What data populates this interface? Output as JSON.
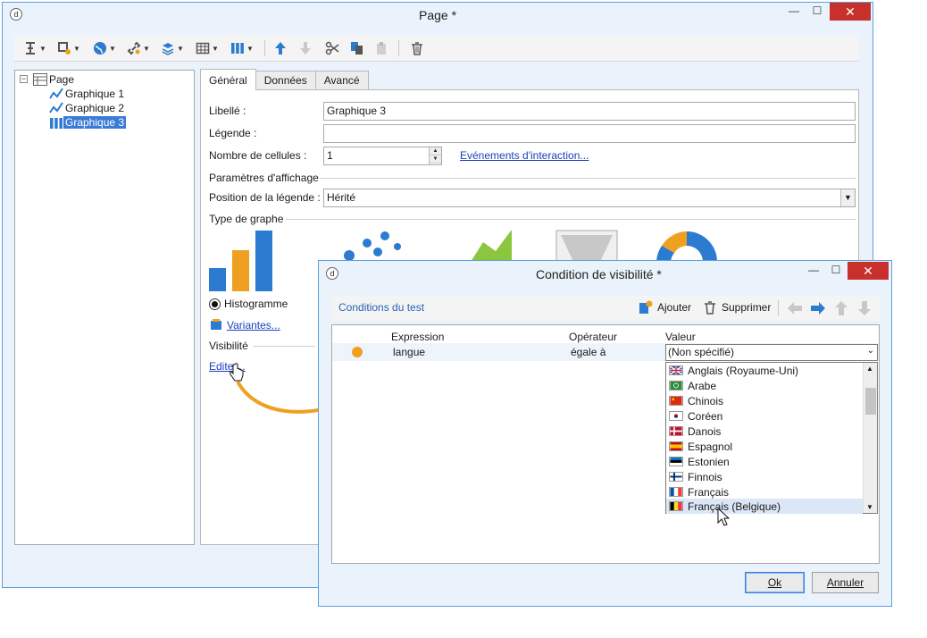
{
  "main_window": {
    "title": "Page *",
    "buttons": {
      "minimize": "—",
      "maximize": "☐",
      "close": "✕"
    },
    "toolbar": {
      "icons": [
        "insert-icon",
        "format-icon",
        "globe-icon",
        "link-icon",
        "layers-icon",
        "table-icon",
        "columns-icon",
        "arrow-up-icon",
        "arrow-down-icon",
        "scissors-icon",
        "copy-icon",
        "paste-icon",
        "trash-icon"
      ]
    },
    "tree": {
      "root": "Page",
      "children": [
        "Graphique 1",
        "Graphique 2",
        "Graphique 3"
      ],
      "selected": "Graphique 3"
    },
    "tabs": [
      "Général",
      "Données",
      "Avancé"
    ],
    "form": {
      "libelle_label": "Libellé :",
      "libelle_value": "Graphique 3",
      "legende_label": "Légende :",
      "legende_value": "",
      "cells_label": "Nombre de cellules :",
      "cells_value": "1",
      "events_link": "Evénements d'interaction...",
      "display_params": "Paramètres d'affichage",
      "legend_pos_label": "Position de la légende :",
      "legend_pos_value": "Hérité",
      "graph_type": "Type de graphe",
      "histogram_label": "Histogramme",
      "variants_link": "Variantes...",
      "visibility": "Visibilité",
      "edit_link": "Editer..."
    },
    "colors": {
      "blue": "#2b7bd0",
      "orange": "#f0a020",
      "green": "#8cc63e",
      "accent": "#c7302b"
    }
  },
  "dialog": {
    "title": "Condition de visibilité *",
    "buttons": {
      "minimize": "—",
      "maximize": "☐",
      "close": "✕"
    },
    "toolbar": {
      "tab_label": "Conditions du test",
      "add": "Ajouter",
      "remove": "Supprimer"
    },
    "grid": {
      "headers": [
        "Expression",
        "Opérateur",
        "Valeur"
      ],
      "row": {
        "expression": "langue",
        "operator": "égale à",
        "value": "(Non spécifié)"
      }
    },
    "languages": [
      "Anglais (Royaume-Uni)",
      "Arabe",
      "Chinois",
      "Coréen",
      "Danois",
      "Espagnol",
      "Estonien",
      "Finnois",
      "Français",
      "Français (Belgique)"
    ],
    "ok": "Ok",
    "cancel": "Annuler"
  }
}
